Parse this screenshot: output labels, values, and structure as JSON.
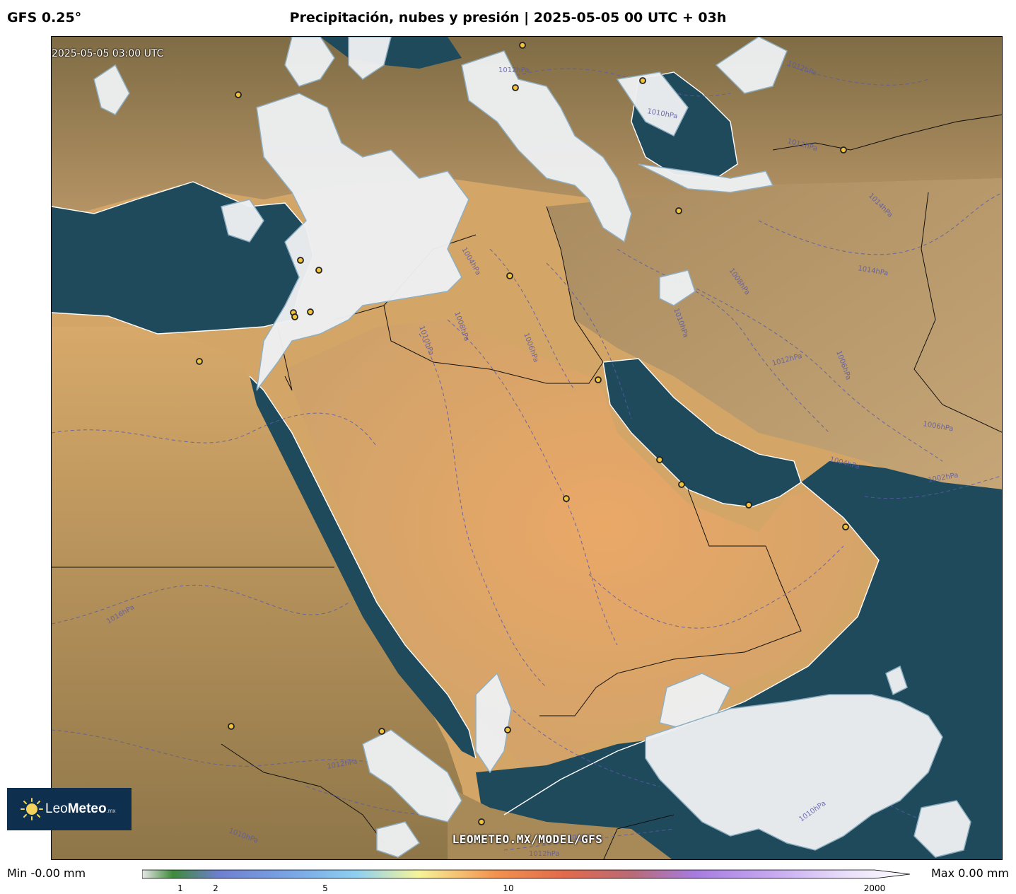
{
  "header": {
    "model": "GFS 0.25°",
    "title": "Precipitación, nubes y presión | 2025-05-05 00 UTC + 03h"
  },
  "map": {
    "valid_time": "2025-05-05 03:00 UTC",
    "watermark": "LEOMETEO.MX/MODEL/GFS",
    "pressure_labels": [
      "1012hPa",
      "1012hPa",
      "1010hPa",
      "1012hPa",
      "1014hPa",
      "1014hPa",
      "1008hPa",
      "1004hPa",
      "1008hPa",
      "1010hPa",
      "1006hPa",
      "1010hPa",
      "1012hPa",
      "1006hPa",
      "1006hPa",
      "1004hPa",
      "1002hPa",
      "1016hPa",
      "1012hPa",
      "1010hPa",
      "1012hPa",
      "1010hPa",
      "1012hPa"
    ],
    "colors": {
      "sea": "#1f4a5c",
      "desert": "#d9a964",
      "cloud": "#eef0f2",
      "isobar": "#5a5aa8",
      "city_marker": "#f2c33a"
    }
  },
  "logo": {
    "name_light": "Leo",
    "name_bold": "Meteo",
    "suffix": ".mx"
  },
  "legend": {
    "min_label": "Min -0.00 mm",
    "max_label": "Max 0.00 mm",
    "ticks": [
      "1",
      "2",
      "5",
      "10",
      "2000"
    ]
  }
}
